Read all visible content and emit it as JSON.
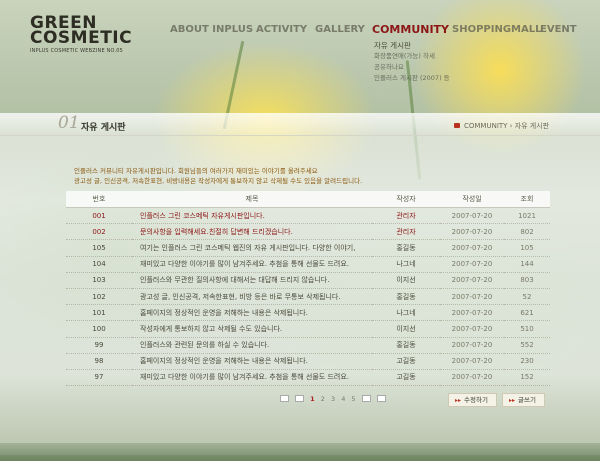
{
  "logo": {
    "line1": "GREEN",
    "line2": "COSMETIC",
    "tagline": "INPLUS COSMETIC WEBZINE NO.05"
  },
  "nav": [
    {
      "label": "ABOUT INPLUS"
    },
    {
      "label": "ACTIVITY"
    },
    {
      "label": "GALLERY"
    },
    {
      "label": "COMMUNITY"
    },
    {
      "label": "SHOPPINGMALL"
    },
    {
      "label": "EVENT"
    }
  ],
  "submenu": [
    "자유 게시판",
    "화장품연애(가능) 하세",
    "공유하나요",
    "인플러스 게시판 (2007) 등"
  ],
  "page": {
    "number": "01",
    "title": "자유 게시판",
    "breadcrumb": "COMMUNITY › 자유 게시판"
  },
  "intro": {
    "line1": "인플러스 커뮤니티 자유게시판입니다. 회원님들의 여러가지 재미있는 이야기를 올려주세요",
    "line2": "광고성 글, 인신공격, 저속한표현, 비방내용은 작성자에게 통보하지 않고 삭제될 수도 있음을 알려드립니다."
  },
  "table": {
    "headers": [
      "번호",
      "제목",
      "작성자",
      "작성일",
      "조회"
    ],
    "rows": [
      {
        "no": "001",
        "title": "인플러스 그린 코스메틱 자유게시판입니다.",
        "author": "관리자",
        "date": "2007-07-20",
        "views": "1021",
        "highlight": true
      },
      {
        "no": "002",
        "title": "문의사항을 입력해세요.친절히 답변해 드리겠습니다.",
        "author": "관리자",
        "date": "2007-07-20",
        "views": "802",
        "highlight": true
      },
      {
        "no": "105",
        "title": "여기는 인플러스 그린 코스메틱 웹진의 자유 게시판입니다. 다양한 이야기,",
        "author": "홍길동",
        "date": "2007-07-20",
        "views": "105",
        "highlight": false
      },
      {
        "no": "104",
        "title": "재미있고 다양한 이야기를 많이 남겨주세요. 추첨을 통해 선물도 드려요.",
        "author": "나그네",
        "date": "2007-07-20",
        "views": "144",
        "highlight": false
      },
      {
        "no": "103",
        "title": "인플러스와 무관한 질의사항에 대해서는 대답해 드리지 않습니다.",
        "author": "이지선",
        "date": "2007-07-20",
        "views": "803",
        "highlight": false
      },
      {
        "no": "102",
        "title": "광고성 글, 인신공격, 저속한표현, 비방 등은 바로 무통보 삭제됩니다.",
        "author": "홍길동",
        "date": "2007-07-20",
        "views": "52",
        "highlight": false
      },
      {
        "no": "101",
        "title": "홈페이지의 정상적인 운영을 저해하는 내용은 삭제됩니다.",
        "author": "나그네",
        "date": "2007-07-20",
        "views": "621",
        "highlight": false
      },
      {
        "no": "100",
        "title": "작성자에게 통보하지 않고 삭제될 수도 있습니다.",
        "author": "이지선",
        "date": "2007-07-20",
        "views": "510",
        "highlight": false
      },
      {
        "no": "99",
        "title": "인플러스와 관련된 문의를 하실 수 있습니다.",
        "author": "홍길동",
        "date": "2007-07-20",
        "views": "552",
        "highlight": false
      },
      {
        "no": "98",
        "title": "홈페이지의 정상적인 운영을 저해하는 내용은 삭제됩니다.",
        "author": "고길동",
        "date": "2007-07-20",
        "views": "230",
        "highlight": false
      },
      {
        "no": "97",
        "title": "재미있고 다양한 이야기를 많이 남겨주세요. 추첨을 통해 선물도 드려요.",
        "author": "고길동",
        "date": "2007-07-20",
        "views": "152",
        "highlight": false
      }
    ]
  },
  "pagination": {
    "pages": [
      "1",
      "2",
      "3",
      "4",
      "5"
    ],
    "current": "1"
  },
  "buttons": {
    "edit": "수정하기",
    "write": "글쓰기"
  }
}
